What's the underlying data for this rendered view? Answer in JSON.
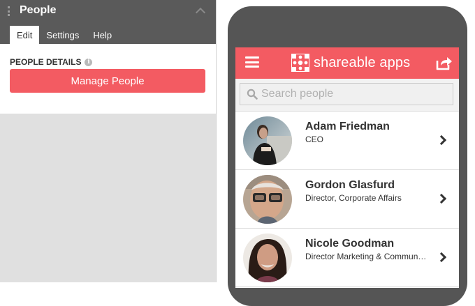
{
  "editor": {
    "title": "People",
    "tabs": [
      {
        "label": "Edit",
        "active": true
      },
      {
        "label": "Settings",
        "active": false
      },
      {
        "label": "Help",
        "active": false
      }
    ],
    "section_label": "PEOPLE DETAILS",
    "info_icon": "info-icon",
    "manage_button": "Manage People"
  },
  "app": {
    "brand_name": "shareable apps",
    "menu_icon": "hamburger-menu-icon",
    "share_icon": "share-icon",
    "search": {
      "placeholder": "Search people",
      "value": ""
    },
    "people": [
      {
        "name": "Adam Friedman",
        "title": "CEO"
      },
      {
        "name": "Gordon Glasfurd",
        "title": "Director, Corporate Affairs"
      },
      {
        "name": "Nicole Goodman",
        "title": "Director Marketing & Communications"
      }
    ]
  },
  "colors": {
    "accent": "#f35b62",
    "panel_header": "#5a5a5a",
    "phone_frame": "#555555"
  }
}
